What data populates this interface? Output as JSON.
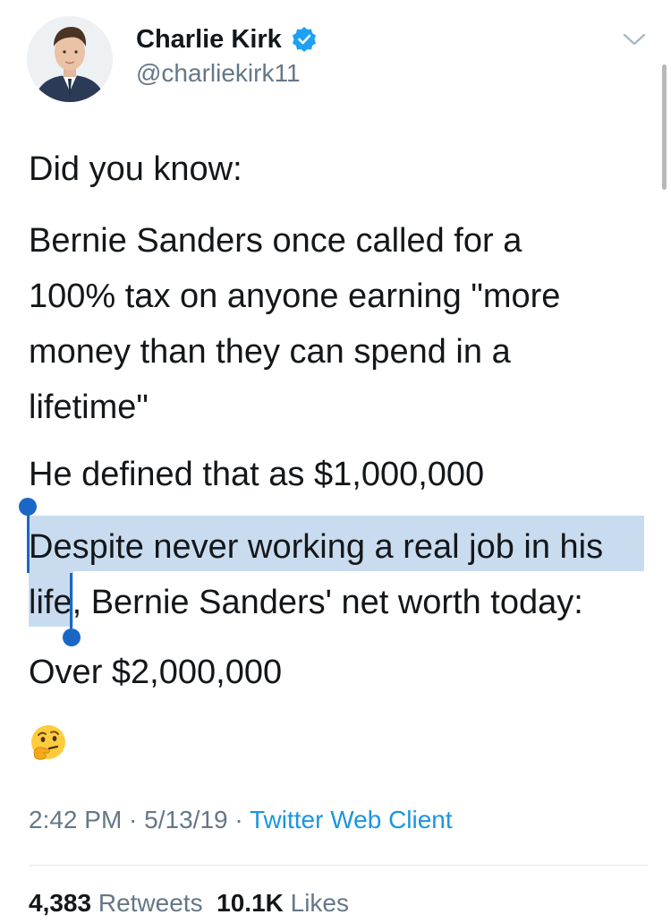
{
  "author": {
    "name": "Charlie Kirk",
    "handle": "@charliekirk11"
  },
  "tweet": {
    "paragraphs": [
      "Did you know:",
      "Bernie Sanders once called for a\n100% tax on anyone earning \"more\nmoney than they can spend in a\nlifetime\"",
      "He defined that as $1,000,000",
      "Despite never working a real job in his\nlife, Bernie Sanders' net worth today:",
      "Over $2,000,000"
    ],
    "emoji_icon": "thinking-face-emoji"
  },
  "meta": {
    "time": "2:42 PM",
    "sep1": " · ",
    "date": "5/13/19",
    "sep2": " · ",
    "source": "Twitter Web Client"
  },
  "stats": {
    "retweets_count": "4,383",
    "retweets_label": "Retweets",
    "likes_count": "10.1K",
    "likes_label": "Likes"
  },
  "colors": {
    "accent": "#1b95e0",
    "selection": "#c9dcef",
    "selection_handle": "#1b67c6",
    "secondary_text": "#657786"
  }
}
